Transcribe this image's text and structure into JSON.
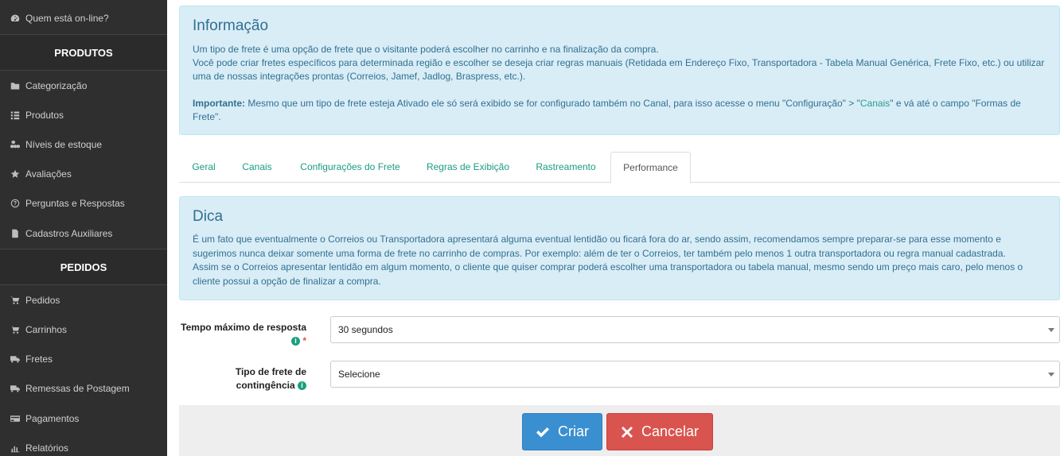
{
  "sidebar": {
    "top_items": [
      {
        "label": "Quem está on-line?",
        "icon": "dashboard-icon"
      }
    ],
    "sections": [
      {
        "title": "PRODUTOS",
        "items": [
          {
            "label": "Categorização",
            "icon": "folder-icon"
          },
          {
            "label": "Produtos",
            "icon": "list-icon"
          },
          {
            "label": "Níveis de estoque",
            "icon": "cubes-icon"
          },
          {
            "label": "Avaliações",
            "icon": "star-icon"
          },
          {
            "label": "Perguntas e Respostas",
            "icon": "question-circle-icon"
          },
          {
            "label": "Cadastros Auxiliares",
            "icon": "file-icon"
          }
        ]
      },
      {
        "title": "PEDIDOS",
        "items": [
          {
            "label": "Pedidos",
            "icon": "cart-icon"
          },
          {
            "label": "Carrinhos",
            "icon": "cart-icon"
          },
          {
            "label": "Fretes",
            "icon": "truck-icon"
          },
          {
            "label": "Remessas de Postagem",
            "icon": "truck-icon"
          },
          {
            "label": "Pagamentos",
            "icon": "credit-card-icon"
          },
          {
            "label": "Relatórios",
            "icon": "bar-chart-icon"
          }
        ]
      }
    ]
  },
  "info": {
    "title": "Informação",
    "line1": "Um tipo de frete é uma opção de frete que o visitante poderá escolher no carrinho e na finalização da compra.",
    "line2": "Você pode criar fretes específicos para determinada região e escolher se deseja criar regras manuais (Retidada em Endereço Fixo, Transportadora - Tabela Manual Genérica, Frete Fixo, etc.) ou utilizar uma de nossas integrações prontas (Correios, Jamef, Jadlog, Braspress, etc.).",
    "important_label": "Importante:",
    "important_text_a": " Mesmo que um tipo de frete esteja Ativado ele só será exibido se for configurado também no Canal, para isso acesse o menu \"Configuração\" > \"",
    "important_link": "Canais",
    "important_text_b": "\" e vá até o campo \"Formas de Frete\"."
  },
  "tabs": [
    {
      "label": "Geral",
      "active": false
    },
    {
      "label": "Canais",
      "active": false
    },
    {
      "label": "Configurações do Frete",
      "active": false
    },
    {
      "label": "Regras de Exibição",
      "active": false
    },
    {
      "label": "Rastreamento",
      "active": false
    },
    {
      "label": "Performance",
      "active": true
    }
  ],
  "tip": {
    "title": "Dica",
    "line1": "É um fato que eventualmente o Correios ou Transportadora apresentará alguma eventual lentidão ou ficará fora do ar, sendo assim, recomendamos sempre preparar-se para esse momento e sugerimos nunca deixar somente uma forma de frete no carrinho de compras. Por exemplo: além de ter o Correios, ter também pelo menos 1 outra transportadora ou regra manual cadastrada.",
    "line2": "Assim se o Correios apresentar lentidão em algum momento, o cliente que quiser comprar poderá escolher uma transportadora ou tabela manual, mesmo sendo um preço mais caro, pelo menos o cliente possui a opção de finalizar a compra."
  },
  "form": {
    "timeout": {
      "label": "Tempo máximo de resposta",
      "required_mark": "*",
      "value": "30 segundos"
    },
    "fallback": {
      "label_line1": "Tipo de frete de",
      "label_line2": "contingência",
      "value": "Selecione"
    }
  },
  "buttons": {
    "create": "Criar",
    "cancel": "Cancelar"
  },
  "colors": {
    "sidebar_bg": "#2f2f2f",
    "info_bg": "#d9edf7",
    "info_text": "#31708f",
    "link": "#1a9c80",
    "primary": "#3a8fd0",
    "danger": "#d9534f"
  }
}
